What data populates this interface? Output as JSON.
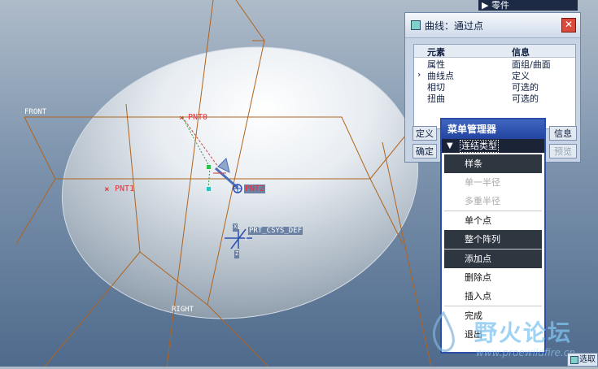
{
  "viewport": {
    "datums": {
      "front": "FRONT",
      "right": "RIGHT"
    },
    "points": {
      "pnt0": "PNT0",
      "pnt1": "PNT1",
      "pnt2": "PNT2"
    },
    "csys_label": "PRT_CSYS_DEF",
    "axis_x": "X",
    "axis_y": "Y",
    "axis_z": "Z"
  },
  "top_menu": {
    "label": "零件"
  },
  "curve_dialog": {
    "title": "曲线：通过点",
    "close": "✕",
    "header": {
      "element": "元素",
      "info": "信息"
    },
    "rows": [
      {
        "marker": "",
        "element": "属性",
        "info": "面组/曲面"
      },
      {
        "marker": "›",
        "element": "曲线点",
        "info": "定义"
      },
      {
        "marker": "",
        "element": "相切",
        "info": "可选的"
      },
      {
        "marker": "",
        "element": "扭曲",
        "info": "可选的"
      }
    ],
    "define_button": "定义",
    "info_button": "信息",
    "ok_button": "确定",
    "preview_button": "预览"
  },
  "menu_manager": {
    "title": "菜单管理器",
    "submenu": "连结类型",
    "items": [
      {
        "label": "样条",
        "state": "selected"
      },
      {
        "label": "单一半径",
        "state": "disabled"
      },
      {
        "label": "多重半径",
        "state": "disabled"
      },
      {
        "label": "单个点",
        "state": "normal"
      },
      {
        "label": "整个阵列",
        "state": "selected"
      },
      {
        "label": "添加点",
        "state": "selected"
      },
      {
        "label": "删除点",
        "state": "normal"
      },
      {
        "label": "插入点",
        "state": "normal"
      },
      {
        "label": "完成",
        "state": "normal"
      },
      {
        "label": "退出",
        "state": "normal"
      }
    ]
  },
  "watermark": {
    "title": "野火论坛",
    "url": "www.proewildfire.cn"
  },
  "status_button": "选取"
}
